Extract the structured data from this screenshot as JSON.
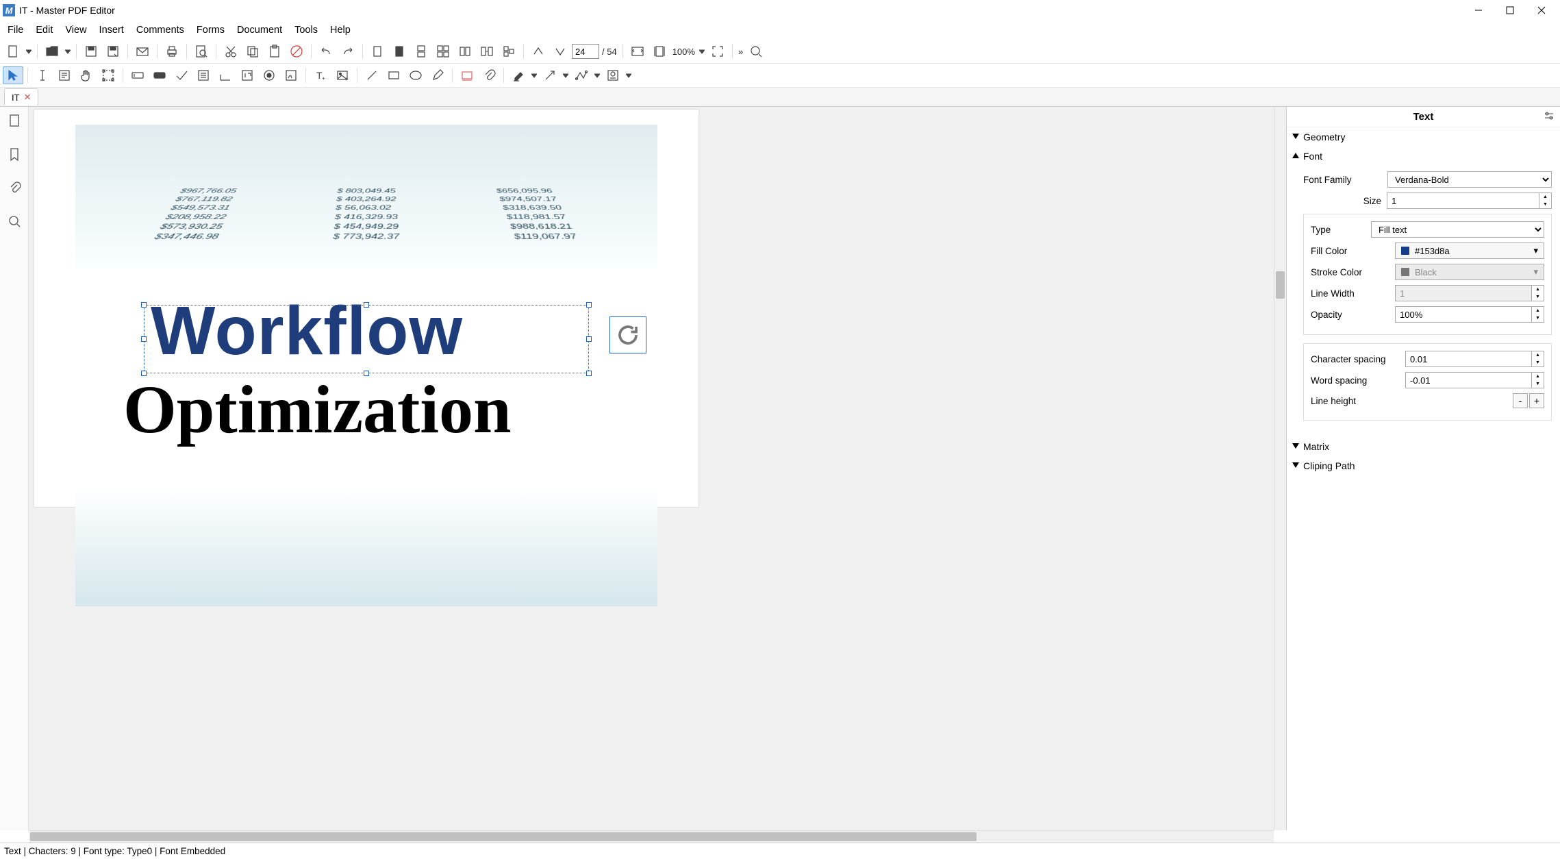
{
  "title": "IT - Master PDF Editor",
  "menu": [
    "File",
    "Edit",
    "View",
    "Insert",
    "Comments",
    "Forms",
    "Document",
    "Tools",
    "Help"
  ],
  "page_current": "24",
  "page_total": "/ 54",
  "zoom": "100%",
  "tab_name": "IT",
  "doc": {
    "word1": "Workflow",
    "word2": "Optimization"
  },
  "bg_numbers": {
    "col1": [
      "$967,766.05",
      "$767,119.82",
      "$549,573.31",
      "$208,958.22",
      "$573,930.25",
      "$347,446.98"
    ],
    "col2": [
      "$ 803,049.45",
      "$ 403,264.92",
      "$  56,063.02",
      "$ 416,329.93",
      "$ 454,949.29",
      "$ 773,942.37"
    ],
    "col3": [
      "$656,095.96",
      "$974,507.17",
      "$318,639.50",
      "$118,981.57",
      "$988,618.21",
      "$119,067.97"
    ]
  },
  "panel": {
    "title": "Text",
    "sections": {
      "geometry": "Geometry",
      "font": "Font",
      "matrix": "Matrix",
      "cliping": "Cliping Path"
    },
    "font_family_label": "Font Family",
    "font_family": "Verdana-Bold",
    "size_label": "Size",
    "size": "1",
    "type_label": "Type",
    "type": "Fill text",
    "fill_label": "Fill Color",
    "fill_color": "#153d8a",
    "stroke_label": "Stroke Color",
    "stroke_color": "Black",
    "lw_label": "Line Width",
    "lw": "1",
    "opacity_label": "Opacity",
    "opacity": "100%",
    "charspace_label": "Character spacing",
    "charspace": "0.01",
    "wordspace_label": "Word spacing",
    "wordspace": "-0.01",
    "lineheight_label": "Line height"
  },
  "status": "Text | Chacters: 9 | Font type: Type0 | Font Embedded"
}
